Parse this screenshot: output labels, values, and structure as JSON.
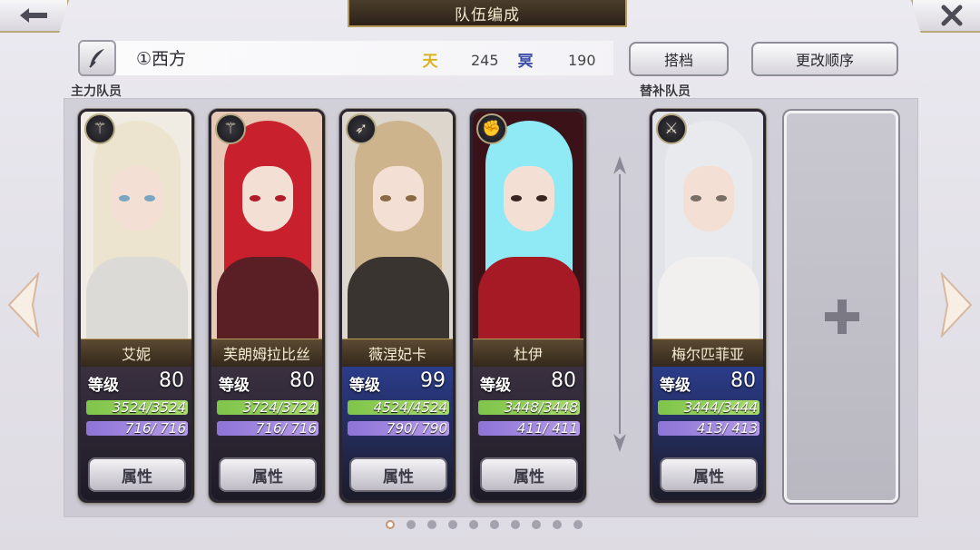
{
  "header": {
    "title": "队伍编成",
    "back_icon": "arrow-left-icon",
    "close_icon": "close-icon"
  },
  "team": {
    "name": "①西方",
    "currency1": {
      "icon": "天",
      "value": "245",
      "color": "#d8b520"
    },
    "currency2": {
      "icon": "冥",
      "value": "190",
      "color": "#3d4fa8"
    },
    "partner_label": "搭档",
    "reorder_label": "更改顺序"
  },
  "sections": {
    "main": "主力队员",
    "sub": "替补队员"
  },
  "cards": [
    {
      "name": "艾妮",
      "level_label": "等级",
      "level": "80",
      "hp": "3524/3524",
      "mp": "716/ 716",
      "attr": "属性",
      "class_icon": "staff-icon",
      "hair": "#ece4cf",
      "eye": "#7aa6c4",
      "body": "#dcdad7",
      "bg": "#f0ece4"
    },
    {
      "name": "芙朗姆拉比丝",
      "level_label": "等级",
      "level": "80",
      "hp": "3724/3724",
      "mp": "716/ 716",
      "attr": "属性",
      "class_icon": "staff-icon",
      "hair": "#c8202c",
      "eye": "#b21c2a",
      "body": "#5a1f25",
      "bg": "#e7c9b6"
    },
    {
      "name": "薇涅妃卡",
      "level_label": "等级",
      "level": "99",
      "hp": "4524/4524",
      "mp": "790/ 790",
      "attr": "属性",
      "class_icon": "bow-icon",
      "hair": "#cdb48d",
      "eye": "#8a6a44",
      "body": "#3a3430",
      "bg": "#ddd6cc"
    },
    {
      "name": "杜伊",
      "level_label": "等级",
      "level": "80",
      "hp": "3448/3448",
      "mp": "411/ 411",
      "attr": "属性",
      "class_icon": "fist-icon",
      "hair": "#8feaf6",
      "eye": "#3a2420",
      "body": "#a51a24",
      "bg": "#3b1218"
    },
    {
      "name": "梅尔匹菲亚",
      "level_label": "等级",
      "level": "80",
      "hp": "3444/3444",
      "mp": "413/ 413",
      "attr": "属性",
      "class_icon": "sword-icon",
      "hair": "#e9eaee",
      "eye": "#7a6f67",
      "body": "#f1f0ee",
      "bg": "#e2e3e8"
    }
  ],
  "empty_slot_icon": "plus-icon",
  "pager": {
    "total": 10,
    "active": 0
  }
}
